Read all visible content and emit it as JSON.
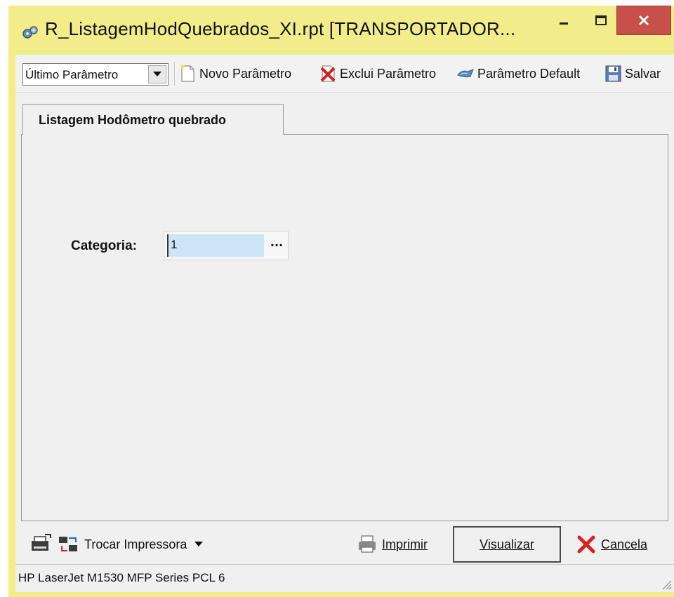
{
  "window": {
    "title": "R_ListagemHodQuebrados_XI.rpt [TRANSPORTADOR...",
    "frame_color": "#f2ed8a",
    "close_color": "#c7504a"
  },
  "toolbar": {
    "param_select_value": "Último Parâmetro",
    "new_param_label": "Novo Parâmetro",
    "delete_param_label": "Exclui Parâmetro",
    "default_param_label": "Parâmetro Default",
    "save_label": "Salvar"
  },
  "tabs": [
    {
      "label": "Listagem Hodômetro quebrado",
      "active": true
    }
  ],
  "form": {
    "categoria_label": "Categoria:",
    "categoria_value": "1",
    "lookup_button_label": "···"
  },
  "bottom": {
    "change_printer_label": "Trocar Impressora",
    "print_label": "Imprimir",
    "preview_label": "Visualizar",
    "cancel_label": "Cancela"
  },
  "status": {
    "printer_name": "HP LaserJet M1530 MFP Series PCL 6"
  },
  "icons": {
    "app": "printer-gear-icon",
    "new": "new-document-icon",
    "delete": "delete-document-icon",
    "default": "default-param-icon",
    "save": "floppy-disk-icon",
    "printer_setup": "printer-setup-icon",
    "swap_printer": "swap-printer-icon",
    "print": "printer-icon",
    "cancel": "red-x-icon"
  }
}
